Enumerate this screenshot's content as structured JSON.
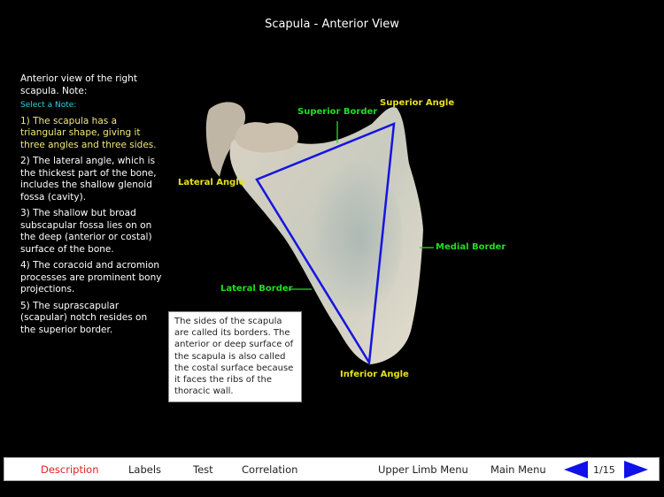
{
  "header": {
    "title": "Scapula - Anterior View"
  },
  "sidebar": {
    "intro": "Anterior view of the right scapula. Note:",
    "select_prompt": "Select a Note:",
    "notes": [
      {
        "text": "1) The scapula has a triangular shape, giving it three angles and three sides.",
        "active": true
      },
      {
        "text": "2) The lateral angle, which is the thickest part of the bone, includes the shallow glenoid fossa (cavity).",
        "active": false
      },
      {
        "text": "3) The shallow but broad subscapular fossa lies on on the deep (anterior or costal) surface of the bone.",
        "active": false
      },
      {
        "text": "4) The coracoid and acromion processes are prominent bony projections.",
        "active": false
      },
      {
        "text": "5) The suprascapular (scapular) notch resides on the superior border.",
        "active": false
      }
    ]
  },
  "figure": {
    "labels": {
      "superior_border": "Superior Border",
      "superior_angle": "Superior Angle",
      "lateral_angle": "Lateral Angle",
      "medial_border": "Medial Border",
      "lateral_border": "Lateral Border",
      "inferior_angle": "Inferior Angle"
    },
    "colors": {
      "angle_label": "#e8e01a",
      "border_label": "#22dd22",
      "triangle": "#1515e0"
    }
  },
  "infobox": {
    "text": "The sides of the scapula are called its borders. The anterior or deep surface of the scapula is also called the costal surface because it faces the ribs of the thoracic wall."
  },
  "bottom_nav": {
    "items": [
      {
        "label": "Description",
        "active": true
      },
      {
        "label": "Labels",
        "active": false
      },
      {
        "label": "Test",
        "active": false
      },
      {
        "label": "Correlation",
        "active": false
      },
      {
        "label": "Upper Limb Menu",
        "active": false
      },
      {
        "label": "Main Menu",
        "active": false
      }
    ],
    "page_indicator": "1/15",
    "prev_icon": "left-triangle-arrow",
    "next_icon": "right-triangle-arrow",
    "active_color": "#e32020",
    "arrow_color": "#1010e8"
  }
}
